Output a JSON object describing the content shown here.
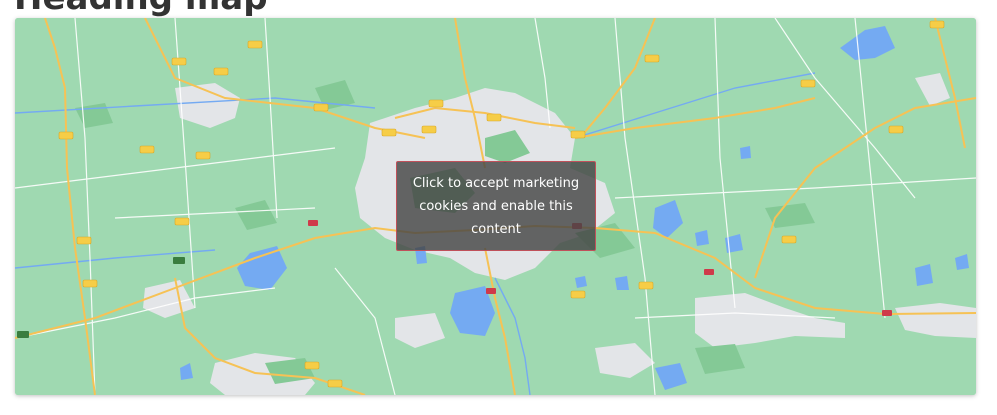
{
  "page": {
    "heading": "Heading map"
  },
  "map": {
    "consent_message": "Click to accept marketing cookies and enable this content",
    "colors": {
      "land": "#9fd9b1",
      "urban": "#e3e5e8",
      "water": "#74aaf2",
      "forest": "#84c996",
      "major_road": "#f6c255",
      "minor_road": "#ffffff",
      "road_shield": "#f6cd47",
      "traffic_red": "#cf3a4a",
      "traffic_green": "#3a7d3f",
      "overlay_border": "#c0505a"
    },
    "icons": [
      "road-shield-icon",
      "traffic-marker-icon"
    ]
  }
}
